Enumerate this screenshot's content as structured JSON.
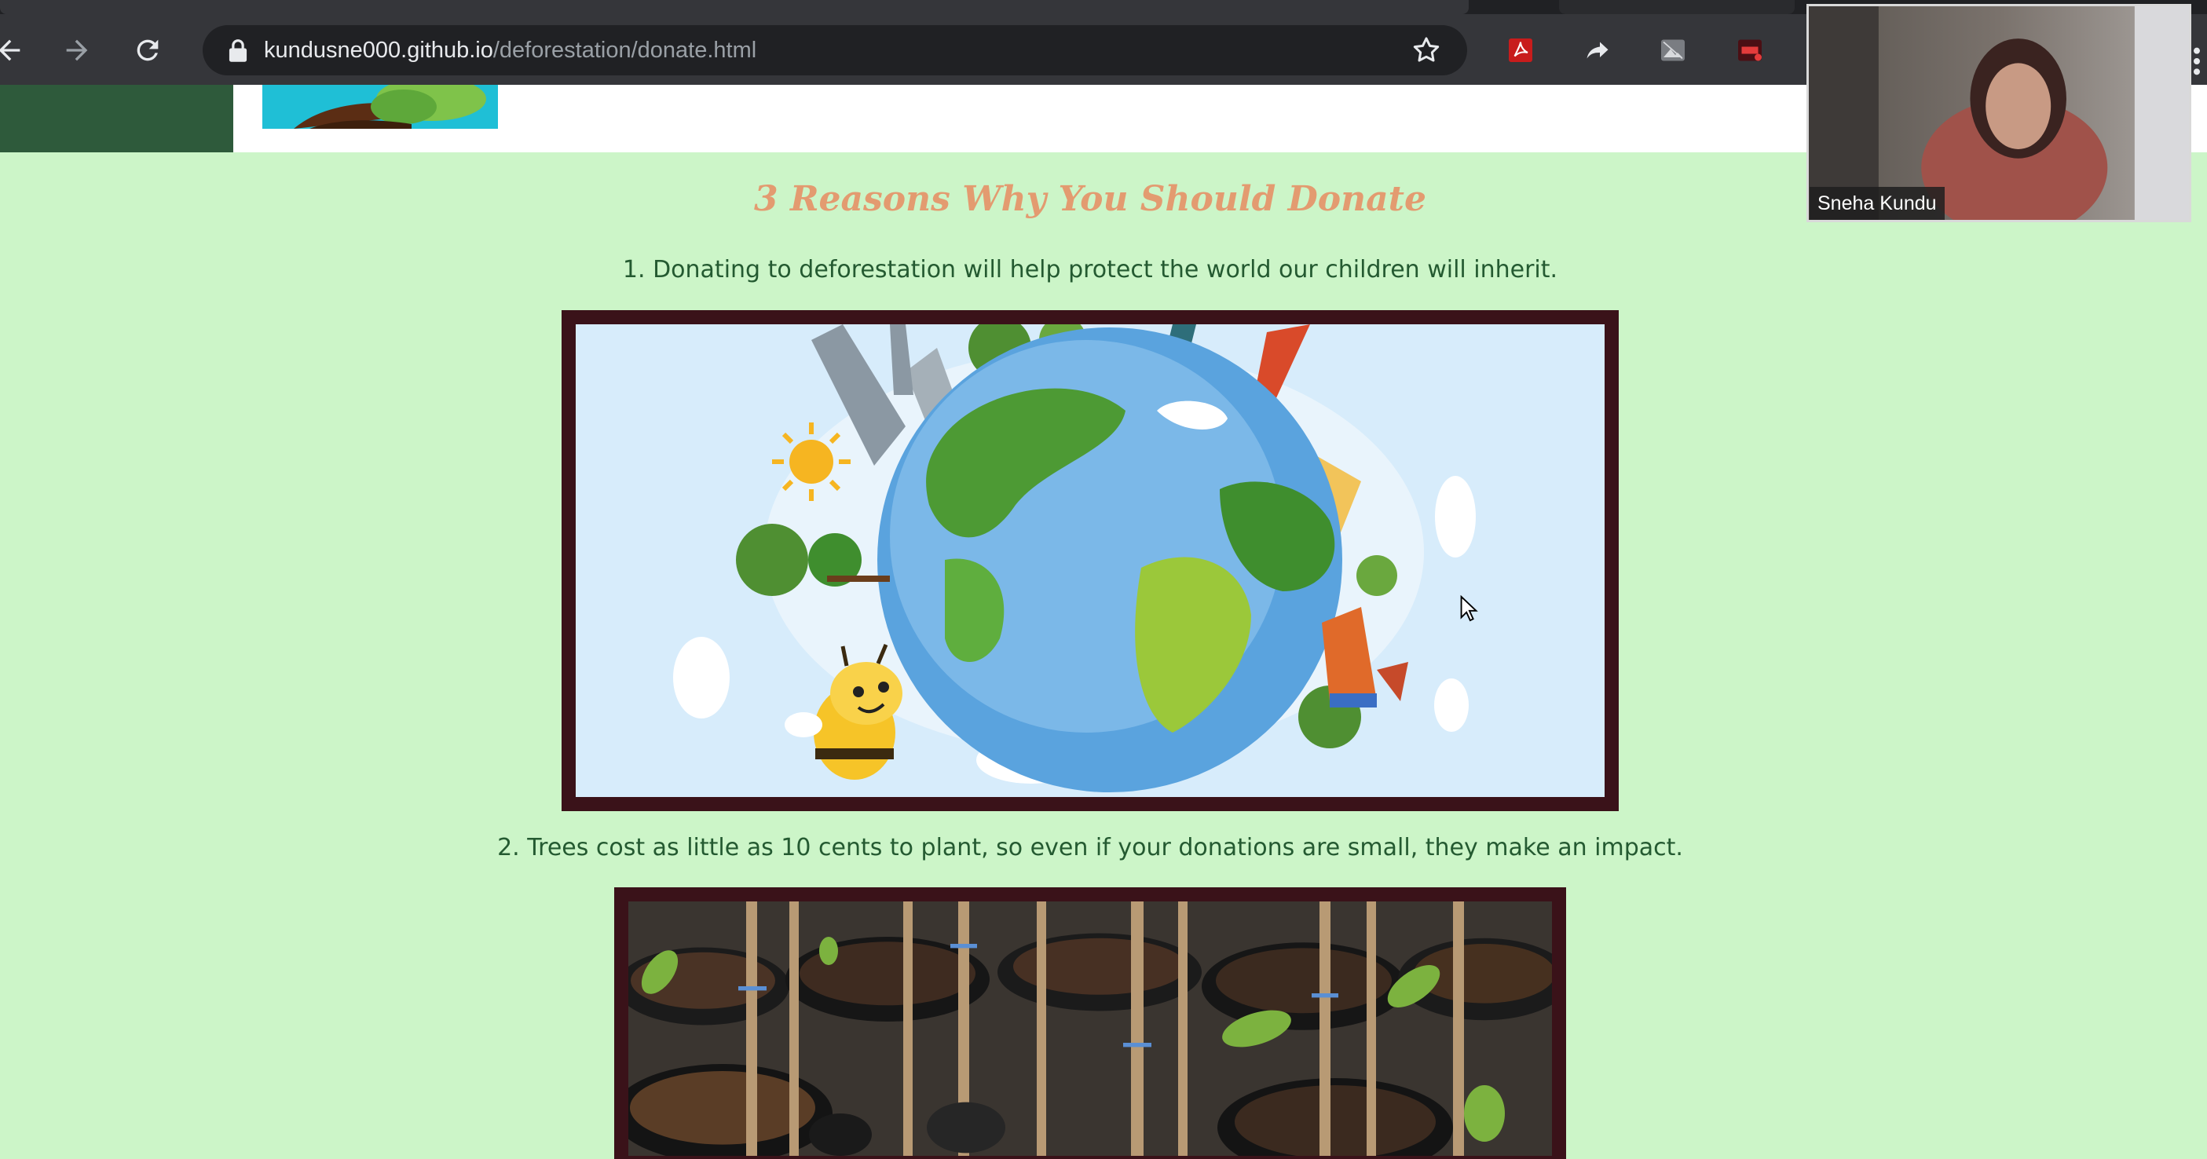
{
  "browser": {
    "url_host": "kundusne000.github.io",
    "url_path": "/deforestation/donate.html",
    "icons": [
      "back-arrow-icon",
      "forward-arrow-icon",
      "reload-icon",
      "lock-icon",
      "bookmark-star-icon",
      "pdf-extension-icon",
      "share-extension-icon",
      "image-extension-icon",
      "sio-extension-icon",
      "kebab-menu-icon"
    ]
  },
  "page": {
    "title": "3 Reasons Why You Should Donate",
    "reasons": [
      "1. Donating to deforestation will help protect the world our children will inherit.",
      "2. Trees cost as little as 10 cents to plant, so even if your donations are small, they make an impact."
    ]
  },
  "video_call": {
    "participant_name": "Sneha Kundu"
  },
  "colors": {
    "page_background": "#ccf5c8",
    "header_green": "#2e5a3b",
    "title_color": "#e39b70",
    "text_color": "#245a31",
    "frame_color": "#3a1219"
  }
}
